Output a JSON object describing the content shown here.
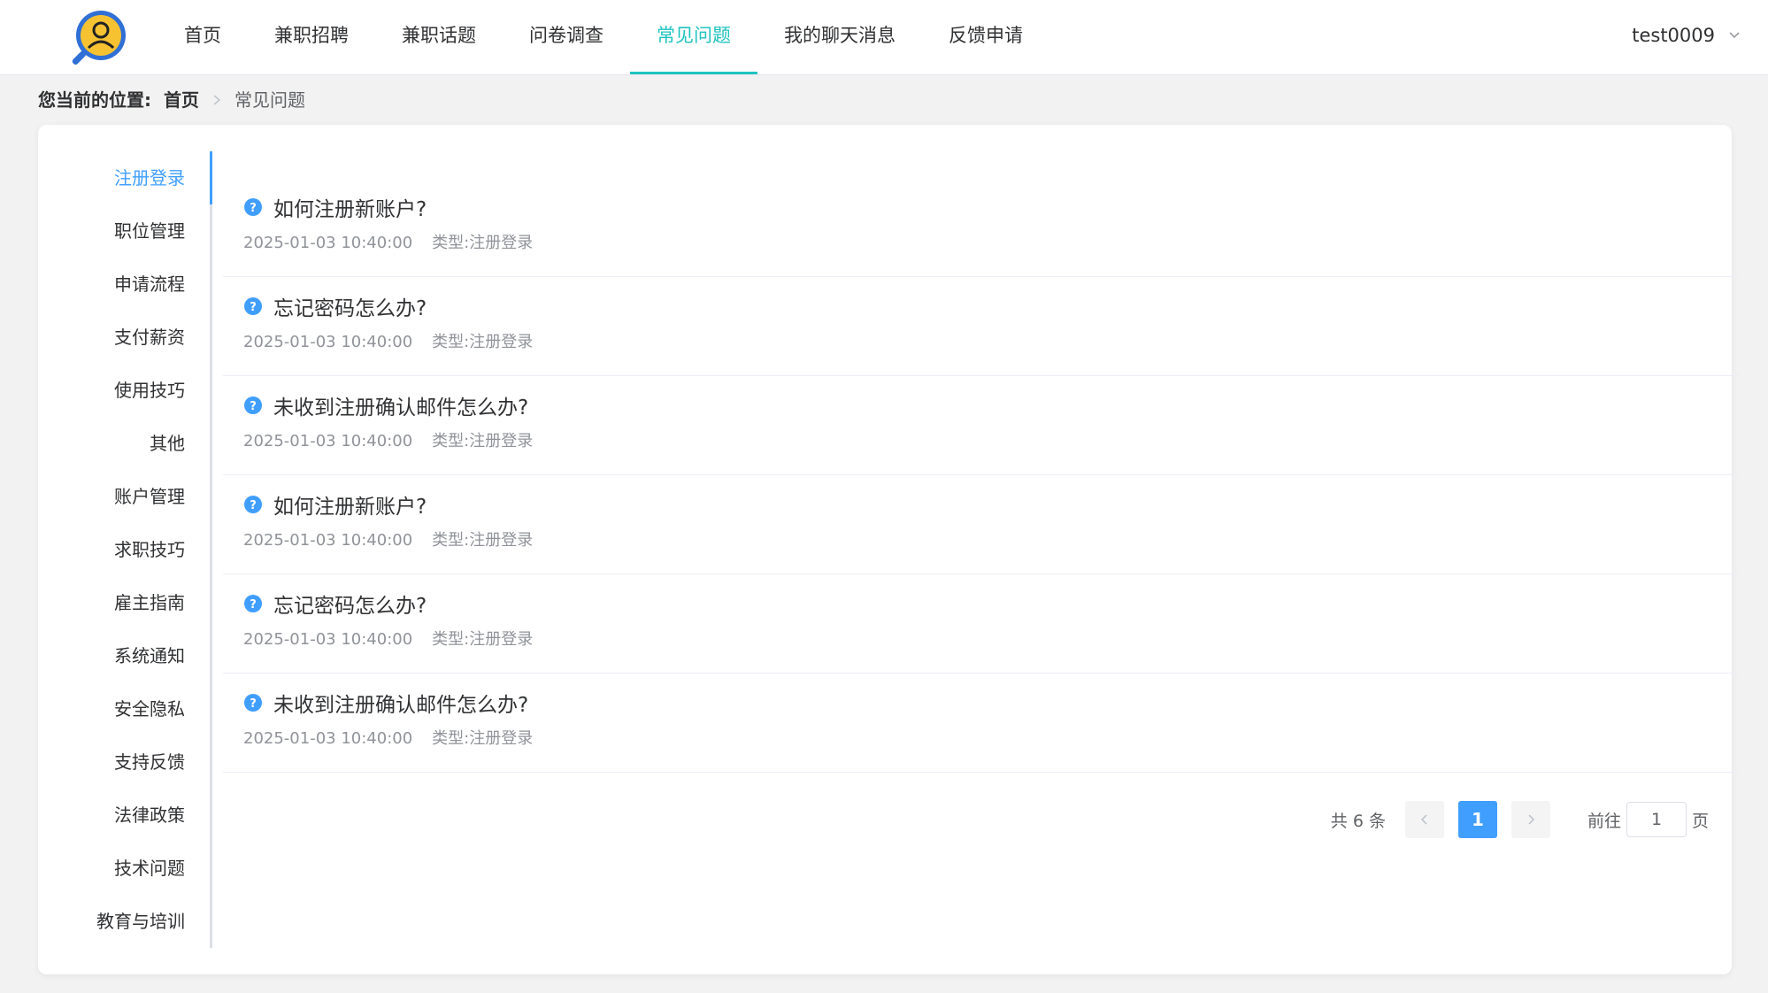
{
  "header": {
    "logo_icon": "magnifier-user-logo-icon",
    "nav": [
      {
        "label": "首页",
        "active": false
      },
      {
        "label": "兼职招聘",
        "active": false
      },
      {
        "label": "兼职话题",
        "active": false
      },
      {
        "label": "问卷调查",
        "active": false
      },
      {
        "label": "常见问题",
        "active": true
      },
      {
        "label": "我的聊天消息",
        "active": false
      },
      {
        "label": "反馈申请",
        "active": false
      }
    ],
    "user": "test0009",
    "user_icon": "chevron-down-icon",
    "active_color": "#1fc3c0"
  },
  "breadcrumb": {
    "prefix": "您当前的位置:",
    "home": "首页",
    "current": "常见问题"
  },
  "sidebar": {
    "items": [
      {
        "label": "注册登录",
        "active": true
      },
      {
        "label": "职位管理",
        "active": false
      },
      {
        "label": "申请流程",
        "active": false
      },
      {
        "label": "支付薪资",
        "active": false
      },
      {
        "label": "使用技巧",
        "active": false
      },
      {
        "label": "其他",
        "active": false
      },
      {
        "label": "账户管理",
        "active": false
      },
      {
        "label": "求职技巧",
        "active": false
      },
      {
        "label": "雇主指南",
        "active": false
      },
      {
        "label": "系统通知",
        "active": false
      },
      {
        "label": "安全隐私",
        "active": false
      },
      {
        "label": "支持反馈",
        "active": false
      },
      {
        "label": "法律政策",
        "active": false
      },
      {
        "label": "技术问题",
        "active": false
      },
      {
        "label": "教育与培训",
        "active": false
      }
    ],
    "active_color": "#409eff"
  },
  "faqs": [
    {
      "title": "如何注册新账户?",
      "time": "2025-01-03 10:40:00",
      "type": "类型:注册登录"
    },
    {
      "title": "忘记密码怎么办?",
      "time": "2025-01-03 10:40:00",
      "type": "类型:注册登录"
    },
    {
      "title": "未收到注册确认邮件怎么办?",
      "time": "2025-01-03 10:40:00",
      "type": "类型:注册登录"
    },
    {
      "title": "如何注册新账户?",
      "time": "2025-01-03 10:40:00",
      "type": "类型:注册登录"
    },
    {
      "title": "忘记密码怎么办?",
      "time": "2025-01-03 10:40:00",
      "type": "类型:注册登录"
    },
    {
      "title": "未收到注册确认邮件怎么办?",
      "time": "2025-01-03 10:40:00",
      "type": "类型:注册登录"
    }
  ],
  "faq_icon": "question-circle-icon",
  "pagination": {
    "total": "共 6 条",
    "current_page": "1",
    "goto_label": "前往",
    "goto_value": "1",
    "page_suffix": "页"
  }
}
